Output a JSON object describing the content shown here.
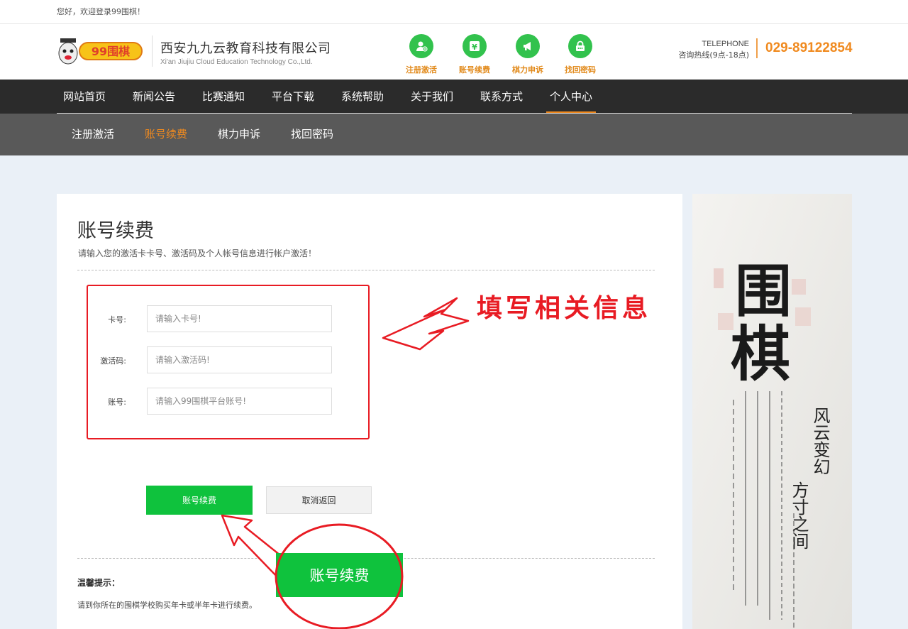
{
  "topbar": {
    "welcome": "您好，欢迎登录99围棋！"
  },
  "header": {
    "logo_text": "99围棋",
    "company_cn": "西安九九云教育科技有限公司",
    "company_en": "Xi'an Jiujiu Cloud Education Technology Co.,Ltd.",
    "quick_links": [
      {
        "label": "注册激活",
        "icon": "user-add-icon"
      },
      {
        "label": "账号续费",
        "icon": "yen-icon"
      },
      {
        "label": "棋力申诉",
        "icon": "megaphone-icon"
      },
      {
        "label": "找回密码",
        "icon": "lock-icon"
      }
    ],
    "telephone_label": "TELEPHONE",
    "hotline_label": "咨询热线(9点-18点)",
    "telephone_number": "029-89122854"
  },
  "nav": {
    "items": [
      "网站首页",
      "新闻公告",
      "比赛通知",
      "平台下载",
      "系统帮助",
      "关于我们",
      "联系方式",
      "个人中心"
    ],
    "active": "个人中心"
  },
  "subnav": {
    "items": [
      "注册激活",
      "账号续费",
      "棋力申诉",
      "找回密码"
    ],
    "active": "账号续费"
  },
  "form": {
    "title": "账号续费",
    "subtitle": "请输入您的激活卡卡号、激活码及个人帐号信息进行帐户激活！",
    "fields": [
      {
        "label": "卡号:",
        "placeholder": "请输入卡号!"
      },
      {
        "label": "激活码:",
        "placeholder": "请输入激活码!"
      },
      {
        "label": "账号:",
        "placeholder": "请输入99围棋平台账号!"
      }
    ],
    "submit_label": "账号续费",
    "cancel_label": "取消返回"
  },
  "tips": {
    "title": "温馨提示：",
    "text": "请到你所在的围棋学校购买年卡或半年卡进行续费。"
  },
  "annotations": {
    "fill_info": "填写相关信息",
    "zoomed_button": "账号续费"
  },
  "banner": {
    "title": "围棋",
    "slogan_1": "风云变幻",
    "slogan_2": "方寸之间"
  },
  "colors": {
    "accent": "#f08a1f",
    "green": "#0fc23d",
    "annotation_red": "#e81b23"
  }
}
